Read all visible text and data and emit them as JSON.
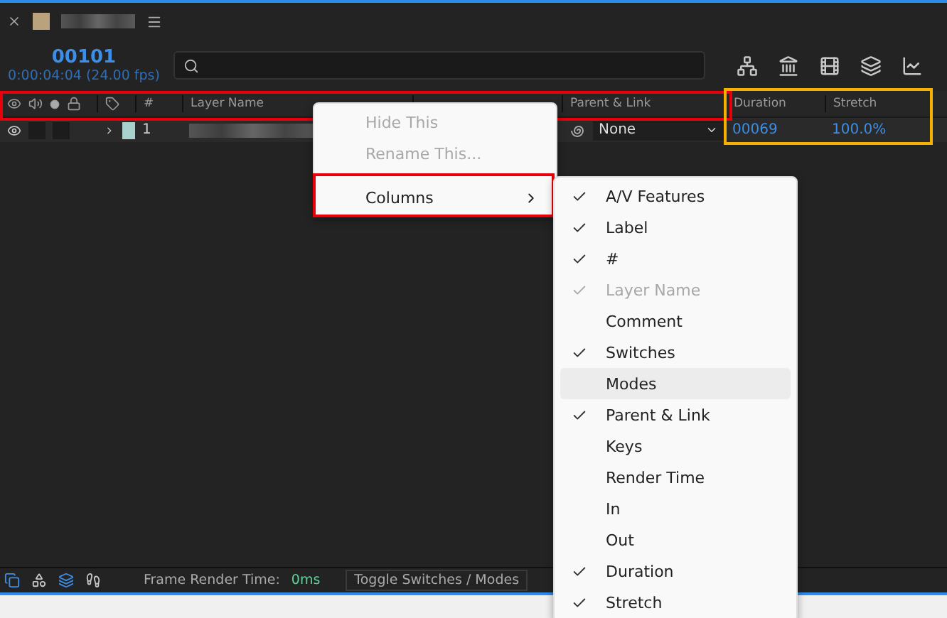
{
  "panel": {
    "timecode": "00101",
    "time_detail": "0:00:04:04 (24.00 fps)"
  },
  "columns": [
    "#",
    "Layer Name",
    "Parent & Link",
    "Duration",
    "Stretch"
  ],
  "layer": {
    "visible": true,
    "number": "1",
    "parent": "None",
    "duration": "00069",
    "stretch": "100.0%",
    "color": "#a9d2cd"
  },
  "context_menu": {
    "items": [
      {
        "label": "Hide This",
        "disabled": true,
        "kind": "item"
      },
      {
        "label": "Rename This...",
        "disabled": true,
        "kind": "item"
      },
      {
        "label": "Columns",
        "disabled": false,
        "kind": "submenu"
      }
    ]
  },
  "columns_menu": {
    "items": [
      {
        "label": "A/V Features",
        "checked": true,
        "disabled": false,
        "selected": false
      },
      {
        "label": "Label",
        "checked": true,
        "disabled": false,
        "selected": false
      },
      {
        "label": "#",
        "checked": true,
        "disabled": false,
        "selected": false
      },
      {
        "label": "Layer Name",
        "checked": true,
        "disabled": true,
        "selected": false
      },
      {
        "label": "Comment",
        "checked": false,
        "disabled": false,
        "selected": false
      },
      {
        "label": "Switches",
        "checked": true,
        "disabled": false,
        "selected": false
      },
      {
        "label": "Modes",
        "checked": false,
        "disabled": false,
        "selected": true
      },
      {
        "label": "Parent & Link",
        "checked": true,
        "disabled": false,
        "selected": false
      },
      {
        "label": "Keys",
        "checked": false,
        "disabled": false,
        "selected": false
      },
      {
        "label": "Render Time",
        "checked": false,
        "disabled": false,
        "selected": false
      },
      {
        "label": "In",
        "checked": false,
        "disabled": false,
        "selected": false
      },
      {
        "label": "Out",
        "checked": false,
        "disabled": false,
        "selected": false
      },
      {
        "label": "Duration",
        "checked": true,
        "disabled": false,
        "selected": false
      },
      {
        "label": "Stretch",
        "checked": true,
        "disabled": false,
        "selected": false
      }
    ]
  },
  "status_bar": {
    "label": "Frame Render Time:",
    "value": "0ms",
    "toggle": "Toggle Switches / Modes"
  }
}
